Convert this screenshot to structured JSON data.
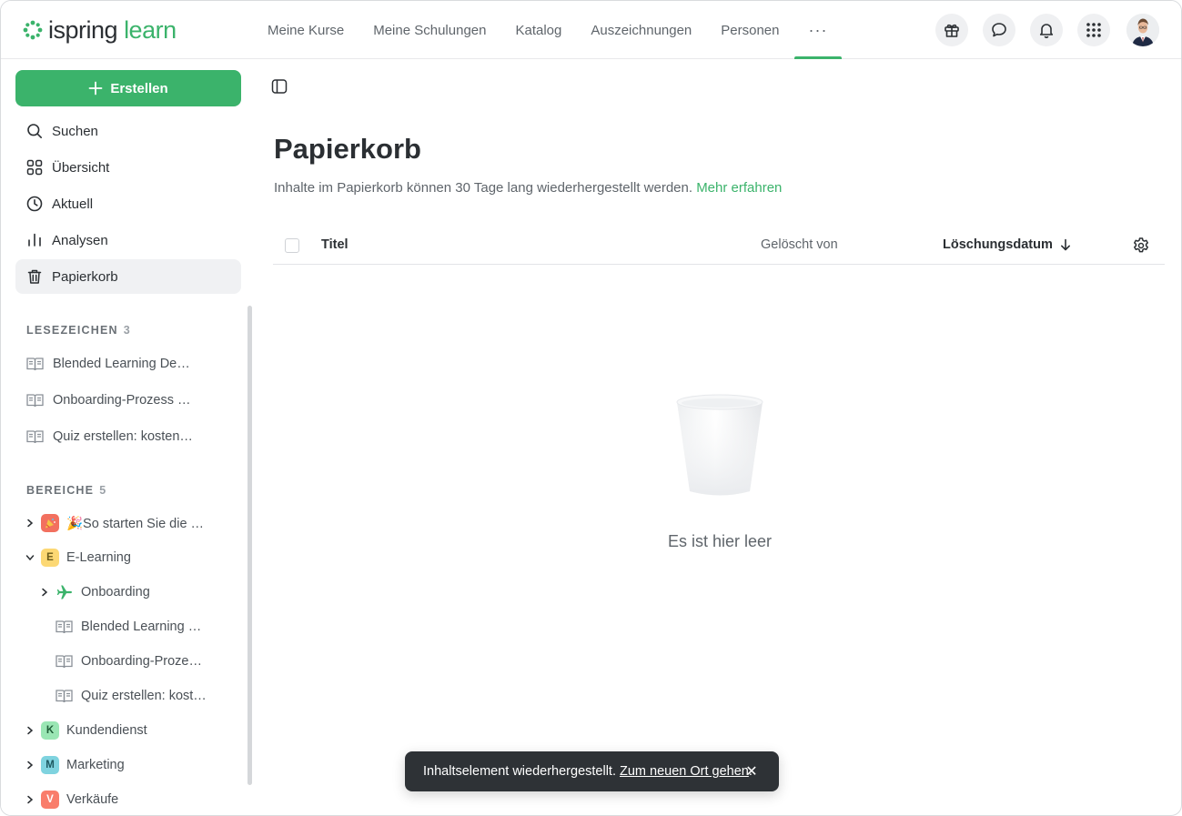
{
  "header": {
    "logo_main": "ispring",
    "logo_accent": "learn",
    "nav": [
      {
        "label": "Meine Kurse"
      },
      {
        "label": "Meine Schulungen"
      },
      {
        "label": "Katalog"
      },
      {
        "label": "Auszeichnungen"
      },
      {
        "label": "Personen"
      },
      {
        "label": "···"
      }
    ],
    "actions": [
      "gift-icon",
      "chat-icon",
      "bell-icon",
      "apps-grid-icon",
      "user-avatar"
    ]
  },
  "sidebar": {
    "create_label": "Erstellen",
    "items": [
      {
        "label": "Suchen",
        "icon": "search-icon"
      },
      {
        "label": "Übersicht",
        "icon": "grid-icon"
      },
      {
        "label": "Aktuell",
        "icon": "clock-icon"
      },
      {
        "label": "Analysen",
        "icon": "chart-icon"
      },
      {
        "label": "Papierkorb",
        "icon": "trash-icon",
        "active": true
      }
    ],
    "bookmarks": {
      "title": "LESEZEICHEN",
      "count": "3",
      "items": [
        {
          "label": "Blended Learning De…"
        },
        {
          "label": "Onboarding-Prozess …"
        },
        {
          "label": "Quiz erstellen: kosten…"
        }
      ]
    },
    "areas": {
      "title": "BEREICHE",
      "count": "5",
      "items": [
        {
          "label": "🎉So starten Sie die …",
          "badge": ""
        },
        {
          "label": "E-Learning",
          "badge": "E"
        },
        {
          "label": "Onboarding",
          "badge": ""
        },
        {
          "label": "Blended Learning …",
          "badge": ""
        },
        {
          "label": "Onboarding-Proze…",
          "badge": ""
        },
        {
          "label": "Quiz erstellen: kost…",
          "badge": ""
        },
        {
          "label": "Kundendienst",
          "badge": "K"
        },
        {
          "label": "Marketing",
          "badge": "M"
        },
        {
          "label": "Verkäufe",
          "badge": "V"
        }
      ]
    }
  },
  "main": {
    "title": "Papierkorb",
    "description": "Inhalte im Papierkorb können 30 Tage lang wiederhergestellt werden.",
    "learn_more": "Mehr erfahren",
    "columns": {
      "title": "Titel",
      "deleted_by": "Gelöscht von",
      "deletion_date": "Löschungsdatum"
    },
    "empty_text": "Es ist hier leer"
  },
  "toast": {
    "message": "Inhaltselement wiederhergestellt.",
    "link": "Zum neuen Ort gehen",
    "suffix": ".",
    "close": "✕"
  },
  "colors": {
    "accent": "#3bb36b",
    "toast_bg": "#2e3236",
    "badge_e": "#fcd874",
    "badge_k": "#9ae6b4",
    "badge_m": "#7fd3df",
    "badge_v": "#f97d6b",
    "badge_so": "#f2705f"
  }
}
